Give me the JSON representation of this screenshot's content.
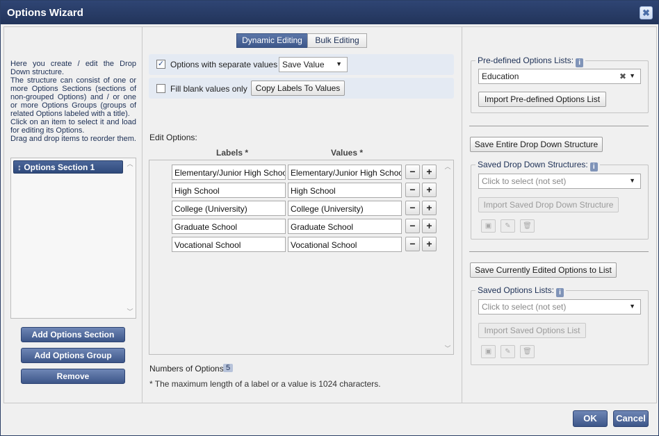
{
  "window": {
    "title": "Options Wizard",
    "close_icon": "close-icon"
  },
  "left": {
    "intro_lines": [
      "Here you create / edit the Drop Down structure.",
      "The structure can consist of one or more Options Sections (sections of non-grouped Options) and / or one or more Options Groups (groups of related Options labeled with a title).",
      "Click on an item to select it and load for editing its Options.",
      "Drag and drop items to reorder them."
    ],
    "tree_item": {
      "icon": "move-icon",
      "label": "Options Section 1"
    },
    "buttons": {
      "add_section": "Add Options Section",
      "add_group": "Add Options Group",
      "remove": "Remove"
    }
  },
  "middle": {
    "tabs": [
      {
        "label": "Dynamic Editing",
        "active": true
      },
      {
        "label": "Bulk Editing",
        "active": false
      }
    ],
    "separate_values": {
      "label": "Options with separate values",
      "checked": true,
      "select_value": "Save Value"
    },
    "fill_blank": {
      "label": "Fill blank values only",
      "checked": false,
      "button": "Copy Labels To Values"
    },
    "edit_options_label": "Edit Options:",
    "col_labels": "Labels *",
    "col_values": "Values *",
    "rows": [
      {
        "label": "Elementary/Junior High School",
        "value": "Elementary/Junior High School"
      },
      {
        "label": "High School",
        "value": "High School"
      },
      {
        "label": "College (University)",
        "value": "College (University)"
      },
      {
        "label": "Graduate School",
        "value": "Graduate School"
      },
      {
        "label": "Vocational School",
        "value": "Vocational School"
      }
    ],
    "count_label": "Numbers of Options:",
    "count": "5",
    "note": "* The maximum length of a label or a value is 1024 characters."
  },
  "right": {
    "predefined": {
      "legend": "Pre-defined Options Lists:",
      "selected": "Education",
      "import_button": "Import Pre-defined Options List"
    },
    "save_structure_button": "Save Entire Drop Down Structure",
    "saved_structures": {
      "legend": "Saved Drop Down Structures:",
      "placeholder": "Click to select (not set)",
      "import_button": "Import Saved Drop Down Structure"
    },
    "save_options_button": "Save Currently Edited Options to List",
    "saved_options": {
      "legend": "Saved Options Lists:",
      "placeholder": "Click to select (not set)",
      "import_button": "Import Saved Options List"
    }
  },
  "footer": {
    "ok": "OK",
    "cancel": "Cancel"
  },
  "colors": {
    "titlebar": "#22345a",
    "accent": "#3d5689",
    "panel": "#f0f0f0",
    "option_row": "#e4eaf3"
  }
}
